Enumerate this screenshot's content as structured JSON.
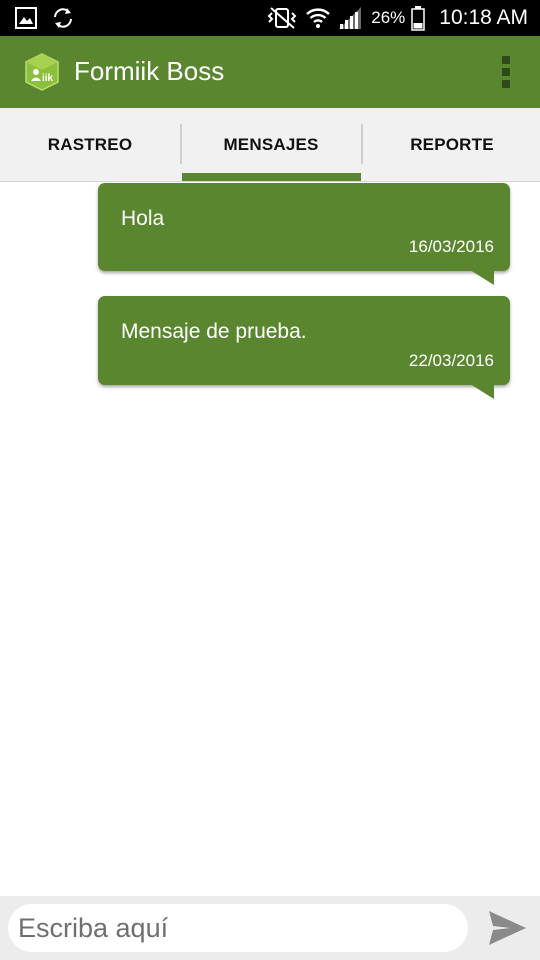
{
  "status_bar": {
    "battery_percent": "26%",
    "time": "10:18 AM",
    "icons": [
      "gallery-icon",
      "sync-icon",
      "vibrate-icon",
      "wifi-icon",
      "signal-icon",
      "battery-icon"
    ]
  },
  "app_bar": {
    "title": "Formiik Boss",
    "logo_text": "iik",
    "logo_icon": "formiik-logo-icon",
    "menu_icon": "overflow-menu-icon"
  },
  "tabs": [
    {
      "label": "RASTREO",
      "selected": false
    },
    {
      "label": "MENSAJES",
      "selected": true
    },
    {
      "label": "REPORTE",
      "selected": false
    }
  ],
  "messages": [
    {
      "text": "Hola",
      "date": "16/03/2016"
    },
    {
      "text": "Mensaje de prueba.",
      "date": "22/03/2016"
    }
  ],
  "composer": {
    "placeholder": "Escriba aquí",
    "value": "",
    "send_icon": "send-icon"
  },
  "colors": {
    "primary": "#5a8630",
    "status_bar": "#000000",
    "tab_background": "#f1f1f1",
    "composer_background": "#ececec"
  }
}
